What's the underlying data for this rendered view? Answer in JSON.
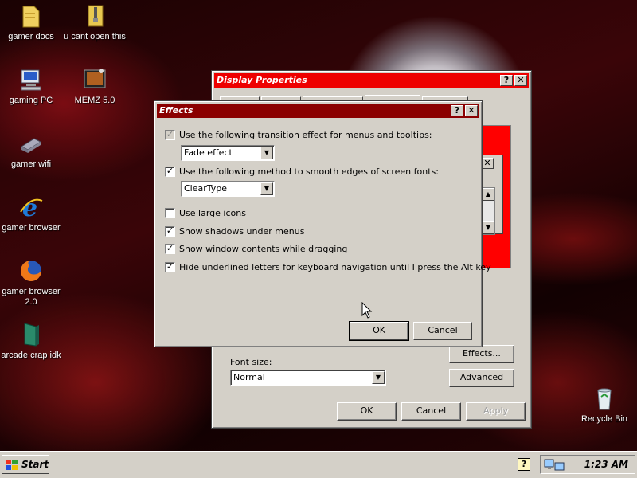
{
  "desktop": {
    "icons": [
      {
        "label": "gamer docs",
        "icon": "folder-icon"
      },
      {
        "label": "u cant open this",
        "icon": "zip-folder-icon"
      },
      {
        "label": "gaming PC",
        "icon": "computer-icon"
      },
      {
        "label": "MEMZ 5.0",
        "icon": "memz-icon"
      },
      {
        "label": "gamer wifi",
        "icon": "network-icon"
      },
      {
        "label": "gamer browser",
        "icon": "ie-icon"
      },
      {
        "label": "gamer browser 2.0",
        "icon": "firefox-icon"
      },
      {
        "label": "arcade crap idk",
        "icon": "arcade-icon"
      },
      {
        "label": "Recycle Bin",
        "icon": "recycle-bin-icon"
      }
    ]
  },
  "display_properties": {
    "title": "Display Properties",
    "font_size_label": "Font size:",
    "font_size_value": "Normal",
    "effects_button": "Effects...",
    "advanced_button": "Advanced",
    "ok": "OK",
    "cancel": "Cancel",
    "apply": "Apply"
  },
  "effects": {
    "title": "Effects",
    "opt_transition": "Use the following transition effect for menus and tooltips:",
    "transition_value": "Fade effect",
    "opt_smooth": "Use the following method to smooth edges of screen fonts:",
    "smooth_value": "ClearType",
    "opt_large_icons": "Use large icons",
    "opt_shadows": "Show shadows under menus",
    "opt_drag": "Show window contents while dragging",
    "opt_underline": "Hide underlined letters for keyboard navigation until I press the Alt key",
    "ok": "OK",
    "cancel": "Cancel",
    "help": "?",
    "close": "✕"
  },
  "taskbar": {
    "start": "Start",
    "clock": "1:23 AM",
    "help": "?"
  },
  "colors": {
    "title_red": "#ee0000",
    "title_dark": "#8b0000",
    "face": "#d4d0c8"
  }
}
